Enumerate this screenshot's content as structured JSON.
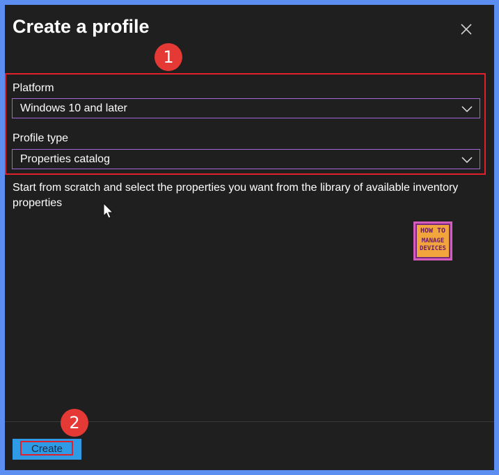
{
  "dialog": {
    "title": "Create a profile",
    "close_icon": "close-icon"
  },
  "annotations": {
    "step1": "1",
    "step2": "2",
    "highlight_color": "#e0202b"
  },
  "form": {
    "platform": {
      "label": "Platform",
      "value": "Windows 10 and later"
    },
    "profile_type": {
      "label": "Profile type",
      "value": "Properties catalog"
    },
    "description": "Start from scratch and select the properties you want from the library of available inventory properties"
  },
  "logo": {
    "line1": "HOW TO",
    "line2": "MANAGE",
    "line3": "DEVICES"
  },
  "footer": {
    "create_label": "Create",
    "button_color": "#2f9ae6"
  }
}
